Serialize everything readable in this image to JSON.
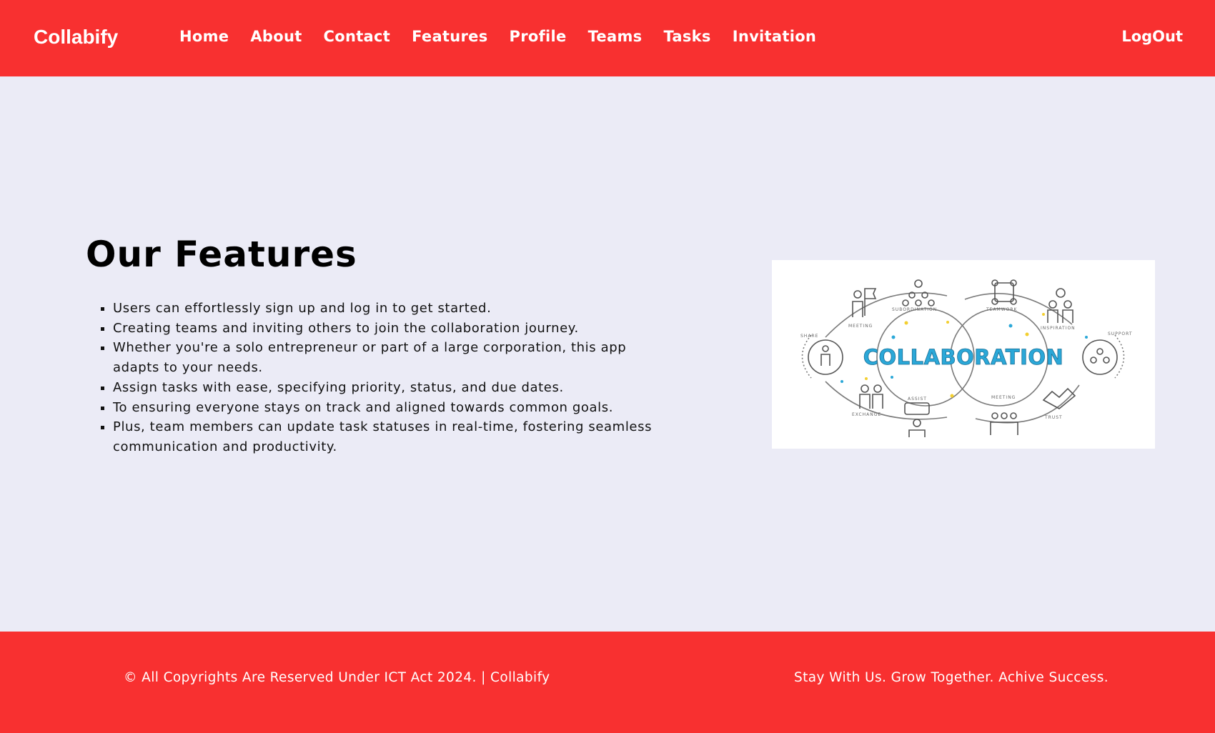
{
  "brand": "Collabify",
  "nav": {
    "items": [
      "Home",
      "About",
      "Contact",
      "Features",
      "Profile",
      "Teams",
      "Tasks",
      "Invitation"
    ],
    "logout": "LogOut"
  },
  "colors": {
    "brand_red": "#f83030",
    "page_bg": "#ebebf6",
    "illustration_blue": "#2ba8d8",
    "illustration_yellow": "#f3cf2f",
    "illustration_gray": "#6d6d6d"
  },
  "features": {
    "title": "Our Features",
    "items": [
      "Users can effortlessly sign up and log in to get started.",
      "Creating teams and inviting others to join the collaboration journey.",
      "Whether you're a solo entrepreneur or part of a large corporation, this app adapts to your needs.",
      "Assign tasks with ease, specifying priority, status, and due dates.",
      "To ensuring everyone stays on track and aligned towards common goals.",
      "Plus, team members can update task statuses in real-time, fostering seamless communication and productivity."
    ]
  },
  "illustration": {
    "headline": "COLLABORATION",
    "labels": [
      "MEETING",
      "SUBORDINATION",
      "TEAMWORK",
      "INSPIRATION",
      "SUPPORT",
      "SHARE",
      "EXCHANGE",
      "ASSIST",
      "MEETING",
      "TRUST"
    ]
  },
  "footer": {
    "copyright": "© All Copyrights Are Reserved Under ICT Act 2024. | Collabify",
    "tagline": "Stay With Us. Grow Together. Achive Success."
  }
}
